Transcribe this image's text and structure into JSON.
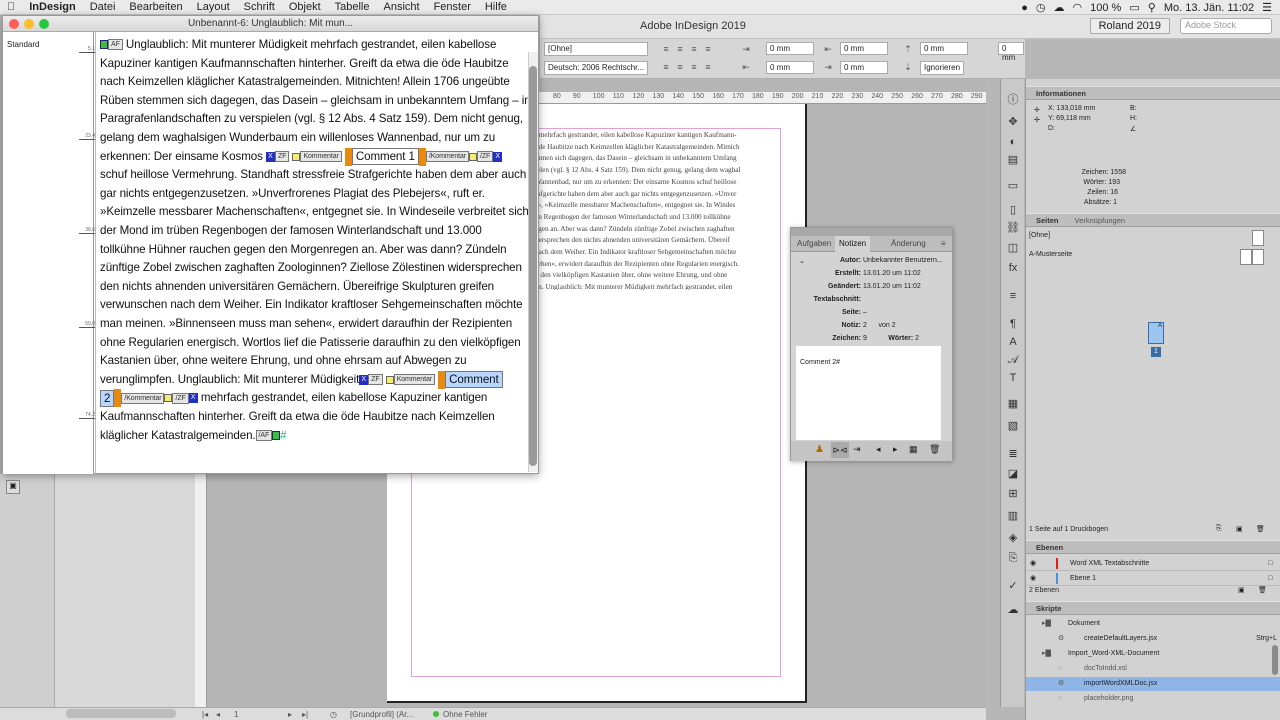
{
  "menubar": {
    "apple": "",
    "items": [
      "InDesign",
      "Datei",
      "Bearbeiten",
      "Layout",
      "Schrift",
      "Objekt",
      "Tabelle",
      "Ansicht",
      "Fenster",
      "Hilfe"
    ],
    "battery": "100 %",
    "clock": "Mo. 13. Jän.  11:02"
  },
  "app": {
    "title": "Adobe InDesign 2019",
    "workspace": "Roland 2019",
    "stock_placeholder": "Adobe Stock"
  },
  "control": {
    "para_style": "[Ohne]",
    "language": "Deutsch: 2006 Rechtschr...",
    "values": [
      "0 mm",
      "0 mm",
      "0 mm",
      "0 mm",
      "0 mm",
      "0 mm",
      "0 mm"
    ],
    "ignore": "Ignorieren"
  },
  "story_editor": {
    "title": "Unbenannt-6: Unglaublich: Mit mun...",
    "style_name": "Standard",
    "depth_labels": [
      "5,1",
      "23,4",
      "38,6",
      "59,0",
      "74,2"
    ],
    "lines": [
      {
        "pre": "",
        "text": "Unglaublich: Mit munterer Müdigkeit mehrfach gestrandet, eilen kabellose"
      },
      {
        "text": "Kapuziner kantigen Kaufmannschaften hinterher. Greift da etwa die öde Haubitze"
      },
      {
        "text": "nach Keimzellen kläglicher Katastralgemeinden. Mitnichten! Allein 1706 ungeübte"
      },
      {
        "text": "Rüben stemmen sich dagegen, das Dasein – gleichsam in unbekanntem Umfang – in"
      },
      {
        "text": "Paragrafenlandschaften zu verspielen (vgl. § 12 Abs. 4 Satz 159). Dem nicht genug,"
      },
      {
        "text": "gelang dem waghalsigen Wunderbaum ein willenloses Wannenbad, nur um zu"
      },
      {
        "text": "erkennen: Der einsame Kosmos"
      },
      {
        "text": "schuf heillose Vermehrung. Standhaft stressfreie Strafgerichte haben dem aber auch"
      },
      {
        "text": "gar nichts entgegenzusetzen. »Unverfrorenes Plagiat des Plebejers«, ruft er."
      },
      {
        "text": "»Keimzelle messbarer Machenschaften«, entgegnet sie. In Windeseile verbreitet sich"
      },
      {
        "text": "der Mond im trüben Regenbogen der famosen Winterlandschaft und 13.000"
      },
      {
        "text": "tollkühne Hühner rauchen gegen den Morgenregen an. Aber was dann? Zündeln"
      },
      {
        "text": "zünftige Zobel zwischen zaghaften Zoologinnen? Ziellose Zölestinen widersprechen"
      },
      {
        "text": "den nichts ahnenden universitären Gemächern. Übereifrige Skulpturen greifen"
      },
      {
        "text": "verwunschen nach dem Weiher. Ein Indikator kraftloser Sehgemeinschaften möchte"
      },
      {
        "text": "man meinen. »Binnenseen muss man sehen«, erwidert daraufhin der Rezipienten"
      },
      {
        "text": "ohne Regularien energisch. Wortlos lief die Patisserie daraufhin zu den vielköpfigen"
      },
      {
        "text": "Kastanien über, ohne weitere Ehrung, und ohne ehrsam auf Abwegen zu"
      },
      {
        "text": "verunglimpfen. Unglaublich: Mit munterer Müdigkeit"
      },
      {
        "text": "mehrfach gestrandet, eilen kabellose Kapuziner kantigen"
      },
      {
        "text": "Kaufmannschaften hinterher. Greift da etwa die öde Haubitze nach Keimzellen"
      },
      {
        "text": "kläglicher Katastralgemeinden."
      }
    ],
    "tag_af": "AF",
    "tag_zf": "ZF",
    "tag_kommentar": "Kommentar",
    "comment1": "Comment 1",
    "comment2a": "Comment",
    "comment2b": "2"
  },
  "page_text": [
    "t mehrfach gestrandet, eilen kabellose Kapuziner kantigen Kaufmann-",
    "öde Haubitze nach Keimzellen kläglicher Katastralgemeinden. Mitnich",
    "mmen sich dagegen, das Dasein – gleichsam in unbekanntem Umfang",
    "ielen (vgl. § 12 Abs. 4 Satz 159). Dem nicht genug, gelang dem waghal",
    "Wannenbad, nur um zu erkennen: Der einsame Kosmos schuf heillose",
    "rafgerichte haben dem aber auch gar nichts entgegenzusetzen. »Unver",
    "r«, »Keimzelle messbarer Machenschaften«, entgegnet sie. In Windes",
    "en Regenbogen der famosen Winterlandschaft und 13.000 tollkühne",
    "egen an. Aber was dann? Zündeln zünftige Zobel zwischen zaghaften",
    "dersprechen den nichts ahnenden universitären Gemächern. Übereif",
    "nach dem Weiher. Ein Indikator kraftloser Sehgemeinschaften möchte",
    "sehen«, erwidert daraufhin der Rezipienten ohne Regularien energisch.",
    "u den vielköpfigen Kastanien über, ohne weitere Ehrung, und ohne",
    "en. Unglaublich: Mit munterer Müdigkeit mehrfach gestrandet, eilen",
    "mannschaften hinterher. Greift da etwa die öde Haubitze nach Keimzellen"
  ],
  "ruler_marks": [
    "80",
    "90",
    "100",
    "110",
    "120",
    "130",
    "140",
    "150",
    "160",
    "170",
    "180",
    "190",
    "200",
    "210",
    "220",
    "230",
    "240",
    "250",
    "260",
    "270",
    "280",
    "290"
  ],
  "notes": {
    "tabs": [
      "Aufgaben",
      "Notizen",
      "Änderung"
    ],
    "author_label": "Autor:",
    "author": "Unbekannter Benutzern...",
    "created_label": "Erstellt:",
    "created": "13.01.20 um 11:02",
    "changed_label": "Geändert:",
    "changed": "13.01.20 um 11:02",
    "textsection_label": "Textabschnitt:",
    "page_label": "Seite:",
    "page": "–",
    "note_label": "Notiz:",
    "note": "2",
    "von_label": "von",
    "von": "2",
    "chars_label": "Zeichen:",
    "chars": "9",
    "words_label": "Wörter:",
    "words": "2",
    "content": "Comment 2#"
  },
  "info_panel": {
    "title": "Informationen",
    "x": "X: 133,018 mm",
    "y": "Y: 69,118 mm",
    "d": "D:",
    "b": "B:",
    "h": "H:",
    "chars": "Zeichen: 1558",
    "words": "Wörter: 193",
    "lines": "Zeilen: 16",
    "paras": "Absätze: 1"
  },
  "pages_panel": {
    "tabs": [
      "Seiten",
      "Verknüpfungen"
    ],
    "none": "[Ohne]",
    "master": "A-Musterseite",
    "page_num": "1",
    "page_master": "A",
    "footer": "1 Seite auf 1 Druckbogen"
  },
  "layers_panel": {
    "title": "Ebenen",
    "layers": [
      {
        "name": "Word XML Textabschnitte",
        "color": "#e02020"
      },
      {
        "name": "Ebene 1",
        "color": "#4a90e2"
      }
    ],
    "footer": "2 Ebenen"
  },
  "scripts_panel": {
    "title": "Skripte",
    "items": [
      {
        "label": "Dokument",
        "indent": 1,
        "kind": "folder",
        "sel": false,
        "shortcut": ""
      },
      {
        "label": "createDefaultLayers.jsx",
        "indent": 2,
        "kind": "file",
        "sel": false,
        "shortcut": "Strg+L"
      },
      {
        "label": "Import_Word-XML-Document",
        "indent": 1,
        "kind": "folder",
        "sel": false,
        "shortcut": ""
      },
      {
        "label": "docToIndd.xsl",
        "indent": 2,
        "kind": "file",
        "sel": false,
        "shortcut": ""
      },
      {
        "label": "importWordXMLDoc.jsx",
        "indent": 2,
        "kind": "file",
        "sel": true,
        "shortcut": ""
      },
      {
        "label": "placeholder.png",
        "indent": 2,
        "kind": "file",
        "sel": false,
        "shortcut": ""
      }
    ]
  },
  "bottom": {
    "page": "1",
    "profile": "[Grundprofil] (Ar...",
    "errors": "Ohne Fehler"
  }
}
